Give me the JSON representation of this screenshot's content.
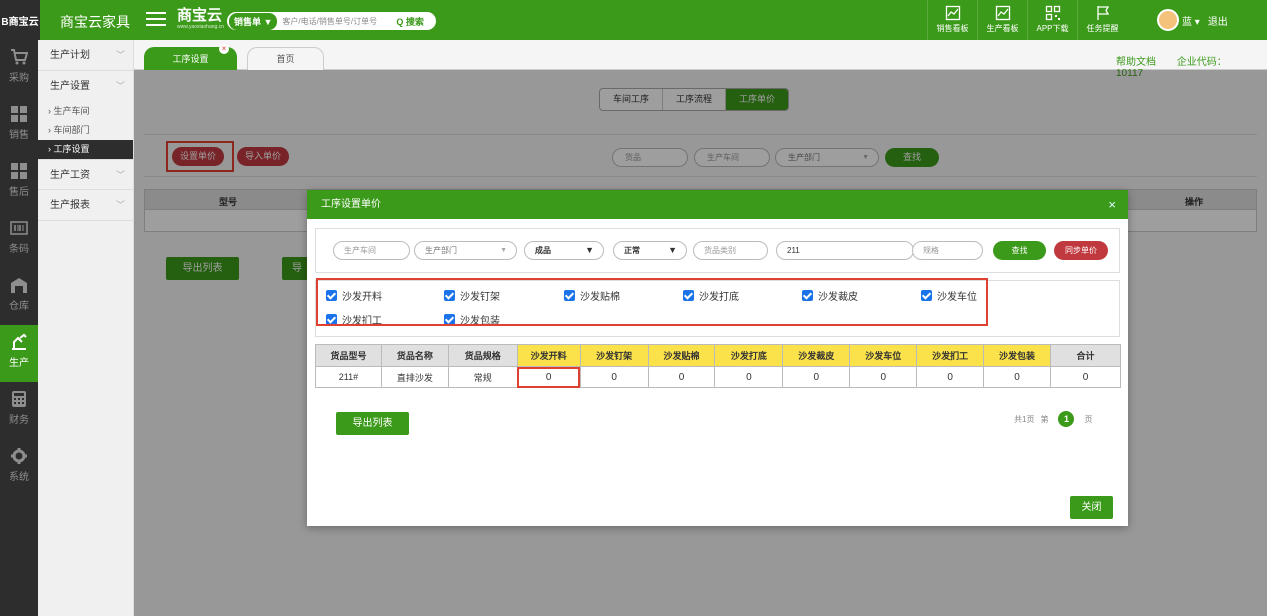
{
  "topbar": {
    "logo_text": "B商宝云",
    "app_title": "商宝云家具",
    "brand_name": "商宝云",
    "brand_url": "www.yaoxiaohang.cn",
    "search": {
      "type_label": "销售单 ▼",
      "placeholder": "客户/电话/销售单号/订单号",
      "button": "Q 搜索"
    },
    "tools": [
      {
        "label": "销售看板",
        "icon": "chart-icon"
      },
      {
        "label": "生产看板",
        "icon": "chart-icon"
      },
      {
        "label": "APP下载",
        "icon": "qrcode-icon"
      },
      {
        "label": "任务提醒",
        "icon": "flag-icon"
      }
    ],
    "user_name": "蓝 ▾",
    "logout": "退出"
  },
  "leftnav": [
    {
      "label": "采购",
      "icon": "cart-icon",
      "active": false
    },
    {
      "label": "销售",
      "icon": "grid-icon",
      "active": false
    },
    {
      "label": "售后",
      "icon": "grid-icon",
      "active": false
    },
    {
      "label": "条码",
      "icon": "barcode-icon",
      "active": false
    },
    {
      "label": "仓库",
      "icon": "warehouse-icon",
      "active": false
    },
    {
      "label": "生产",
      "icon": "production-icon",
      "active": true
    },
    {
      "label": "财务",
      "icon": "calculator-icon",
      "active": false
    },
    {
      "label": "系统",
      "icon": "gear-icon",
      "active": false
    }
  ],
  "submenu": {
    "production_plan": "生产计划",
    "production_settings": "生产设置",
    "items": [
      "› 生产车间",
      "› 车间部门",
      "› 工序设置"
    ],
    "wages": "生产工资",
    "reports": "生产报表"
  },
  "tabs": {
    "active": "工序设置",
    "inactive": "首页",
    "close_glyph": "×"
  },
  "links": {
    "help": "帮助文档",
    "company_code": "企业代码：10117"
  },
  "segments": [
    "车间工序",
    "工序流程",
    "工序单价"
  ],
  "page_toolbar": {
    "set_price": "设置单价",
    "import_price": "导入单价",
    "product_ph": "货品",
    "workshop_ph": "生产车间",
    "dept_ph": "生产部门",
    "search": "查找"
  },
  "bg_table": {
    "model": "型号",
    "op": "操作"
  },
  "bg_export": "导出列表",
  "bg_export_clipped": "导",
  "modal": {
    "title": "工序设置单价",
    "close_glyph": "×",
    "filters": {
      "workshop_ph": "生产车间",
      "dept_ph": "生产部门",
      "type_value": "成品",
      "status_value": "正常",
      "category_ph": "货品类别",
      "keyword_value": "211",
      "spec_ph": "规格",
      "search": "查找",
      "sync": "同步单价"
    },
    "checkboxes": [
      "沙发开料",
      "沙发钉架",
      "沙发贴棉",
      "沙发打底",
      "沙发裁皮",
      "沙发车位",
      "沙发扪工",
      "沙发包装"
    ],
    "table": {
      "headers": [
        "货品型号",
        "货品名称",
        "货品规格",
        "沙发开料",
        "沙发钉架",
        "沙发贴棉",
        "沙发打底",
        "沙发裁皮",
        "沙发车位",
        "沙发扪工",
        "沙发包装",
        "合计"
      ],
      "rows": [
        [
          "211#",
          "直排沙发",
          "常规",
          "0",
          "0",
          "0",
          "0",
          "0",
          "0",
          "0",
          "0",
          "0"
        ]
      ]
    },
    "export": "导出列表",
    "pager": {
      "total": "共1页",
      "page_prefix": "第",
      "current": "1",
      "page_suffix": "页"
    },
    "close_button": "关闭"
  },
  "colors": {
    "brand_green": "#3c9a1b",
    "nav_dark": "#2d2d2d",
    "red_button": "#c0393f",
    "highlight_red": "#e04030",
    "header_yellow": "#fbe24b",
    "checkbox_blue": "#1a73e8"
  }
}
